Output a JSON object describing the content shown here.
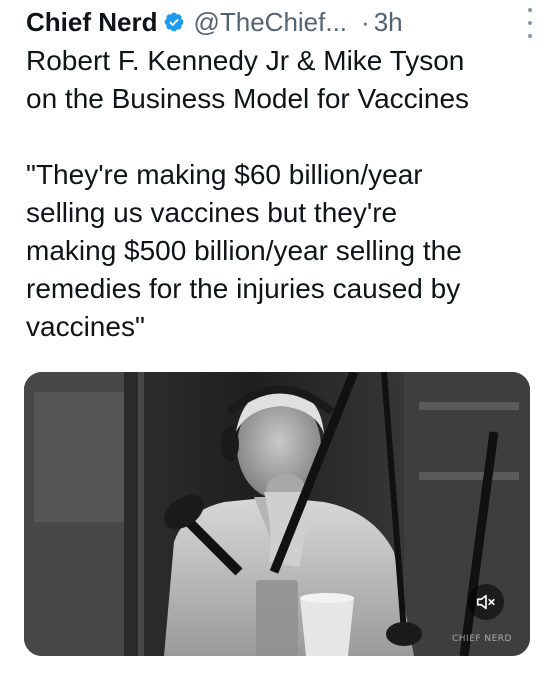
{
  "tweet": {
    "author_name": "Chief Nerd",
    "handle": "@TheChief...",
    "separator": "·",
    "time": "3h",
    "verified_color": "#1d9bf0",
    "text_lines": [
      "Robert F. Kennedy Jr & Mike Tyson",
      "on the Business Model for Vaccines"
    ],
    "quote_lines": [
      "\"They're making $60 billion/year",
      "selling us vaccines but they're",
      "making $500 billion/year selling the",
      "remedies for the injuries caused by",
      "vaccines\""
    ]
  },
  "media": {
    "type": "video",
    "muted": true,
    "watermark": "CHIEF NERD",
    "icons": {
      "mute": "speaker-muted-icon",
      "more": "more-options-icon",
      "verified": "verified-badge-icon"
    }
  }
}
